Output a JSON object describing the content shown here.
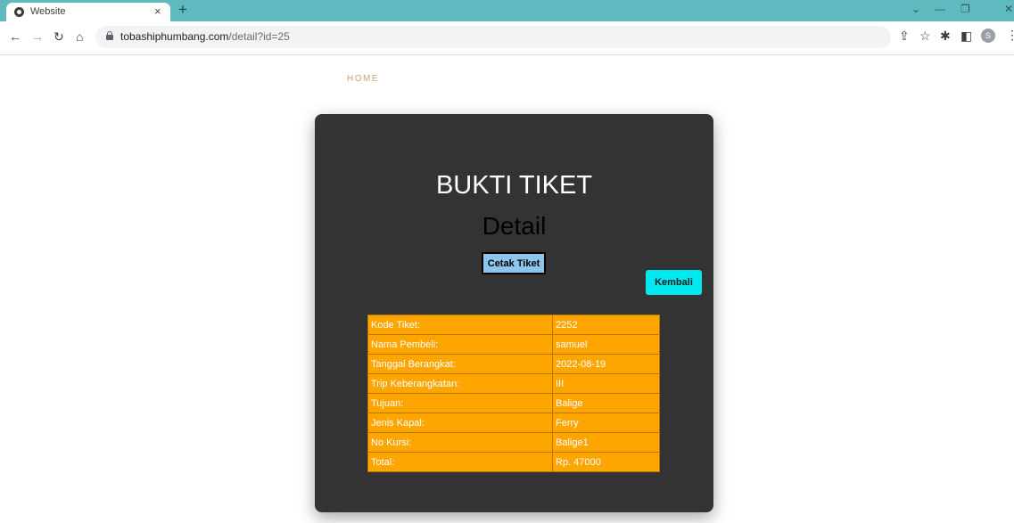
{
  "browser": {
    "tab_title": "Website",
    "tab_close": "×",
    "new_tab": "+",
    "url_domain": "tobashiphumbang.com",
    "url_path": "/detail?id=25",
    "avatar_letter": "S",
    "icons": [
      "back-arrow-icon",
      "forward-arrow-icon",
      "reload-icon",
      "home-icon",
      "lock-icon",
      "share-icon",
      "star-icon",
      "extensions-icon",
      "sidebar-icon",
      "profile-avatar",
      "menu-icon"
    ]
  },
  "nav": {
    "home_label": "HOME"
  },
  "card": {
    "title": "BUKTI TIKET",
    "subtitle": "Detail",
    "print_button": "Cetak Tiket",
    "back_button": "Kembali"
  },
  "ticket": {
    "rows": [
      {
        "label": "Kode Tiket:",
        "value": "2252"
      },
      {
        "label": "Nama Pembeli:",
        "value": "samuel"
      },
      {
        "label": "Tanggal Berangkat:",
        "value": "2022-08-19"
      },
      {
        "label": "Trip Keberangkatan:",
        "value": "III"
      },
      {
        "label": "Tujuan:",
        "value": "Balige"
      },
      {
        "label": "Jenis Kapal:",
        "value": "Ferry"
      },
      {
        "label": "No Kursi:",
        "value": "Balige1"
      },
      {
        "label": "Total:",
        "value": "Rp. 47000"
      }
    ]
  },
  "colors": {
    "tabbar": "#5fbac0",
    "card_bg": "#333333",
    "table_bg": "#ffa500",
    "print_button_bg": "#8ec5ec",
    "back_button_bg": "#00e8f0",
    "home_link": "#c8a27a"
  }
}
